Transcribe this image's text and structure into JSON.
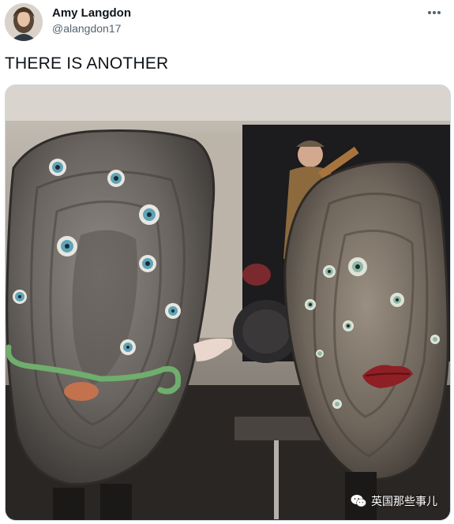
{
  "tweet": {
    "author": {
      "display_name": "Amy Langdon",
      "handle": "@alangdon17",
      "avatar_icon": "avatar-photo"
    },
    "text": "THERE IS ANOTHER",
    "more_icon": "more-dots-icon"
  },
  "media": {
    "watermark": {
      "icon": "wechat-icon",
      "text": "英国那些事儿"
    }
  },
  "colors": {
    "name_text": "#0f1419",
    "handle_text": "#536471",
    "border": "#cfd9de"
  }
}
